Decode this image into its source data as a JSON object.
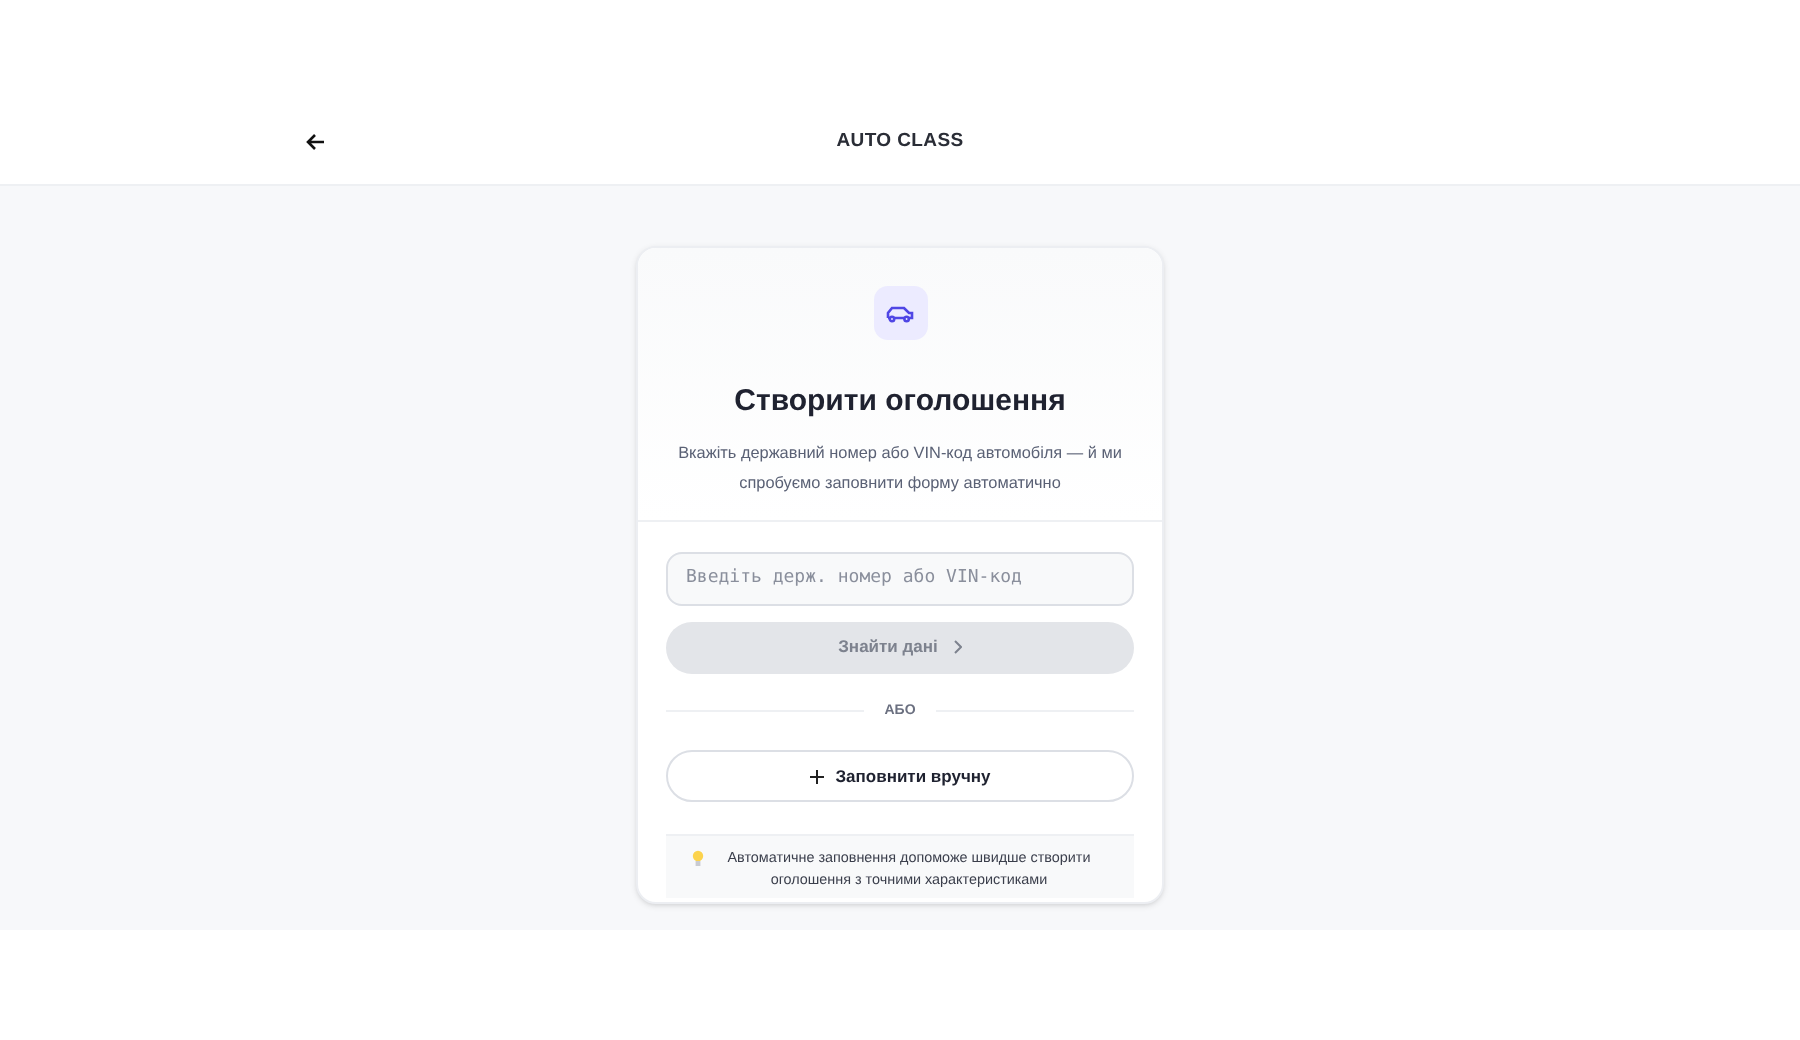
{
  "header": {
    "title": "AUTO CLASS"
  },
  "card": {
    "title": "Створити оголошення",
    "subtitle": "Вкажіть державний номер або VIN-код автомобіля — й ми спробуємо заповнити форму автоматично"
  },
  "search": {
    "placeholder": "Введіть держ. номер або VIN-код"
  },
  "find_button": {
    "label": "Знайти дані",
    "disabled": true
  },
  "divider": {
    "label": "АБО"
  },
  "manual_button": {
    "label": "Заповнити вручну"
  },
  "tip": {
    "text": "Автоматичне заповнення допоможе швидше створити оголошення з точними характеристиками"
  }
}
